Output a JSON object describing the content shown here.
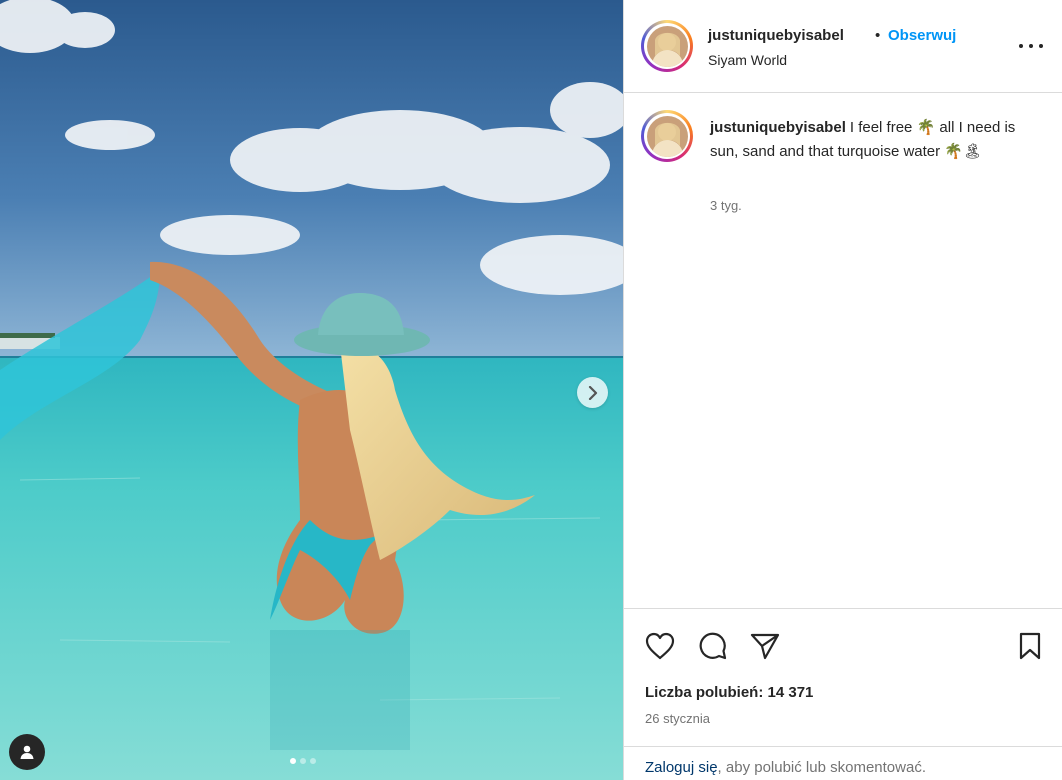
{
  "post": {
    "username": "justuniquebyisabel",
    "separator": "•",
    "follow_label": "Obserwuj",
    "location": "Siyam World",
    "caption": "I feel free 🌴 all I need is sun, sand and that turquoise water 🌴🏝",
    "caption_time": "3 tyg.",
    "likes_text": "Liczba polubień: 14 371",
    "date": "26 stycznia",
    "login_link": "Zaloguj się",
    "login_rest": ", aby polubić lub skomentować."
  },
  "carousel": {
    "total_images": 3,
    "current_index": 1
  },
  "icons": {
    "more": "more-options-icon",
    "like": "heart-icon",
    "comment": "comment-icon",
    "share": "share-icon",
    "save": "bookmark-icon",
    "next": "chevron-right-icon",
    "user_tag": "user-tag-icon"
  },
  "colors": {
    "link_blue": "#0095f6",
    "dark_link": "#00376b",
    "text": "#262626",
    "muted": "#737373",
    "border": "#dbdbdb"
  }
}
